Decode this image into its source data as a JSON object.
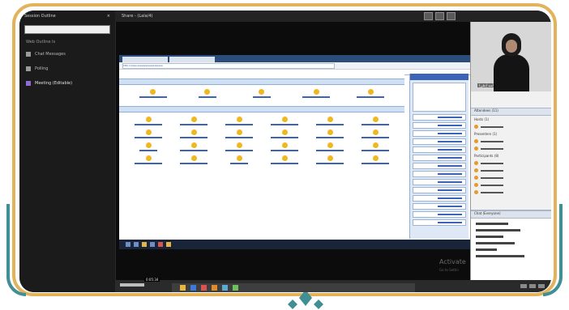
{
  "session": {
    "panel_title": "Session Outline",
    "panel_subtitle": "Web Outline ls",
    "items": [
      {
        "label": "Chat Messages",
        "icon": "chat-icon"
      },
      {
        "label": "Polling",
        "icon": "poll-icon"
      },
      {
        "label": "Meeting (Editable)",
        "icon": "meeting-icon"
      }
    ]
  },
  "top_bar": {
    "title": "Share - (Lala/4)"
  },
  "shared_screen": {
    "tab_labels": [
      "",
      ""
    ],
    "address_text": "http://www.aaaaa/aaaaaa/aaaaa",
    "watermark_line1": "Activate",
    "watermark_line2": "Go to Settin"
  },
  "video": {
    "tile_label": "Video",
    "person_name": "آمنه (علي)"
  },
  "attendees": {
    "section_title": "Attendees (11)",
    "host_group": "Hosts (1)",
    "presenter_group": "Presenters (1)",
    "participant_group": "Participants (8)",
    "rows": [
      "",
      "",
      "",
      "",
      "",
      "",
      "",
      "",
      ""
    ]
  },
  "chat": {
    "section_title": "Chat (Everyone)"
  },
  "player": {
    "time": "0:05:34"
  },
  "colors": {
    "frame_gold": "#e2b35b",
    "frame_teal": "#3f8f95",
    "link_blue": "#3b63b8",
    "icon_yellow": "#f0b81c"
  }
}
